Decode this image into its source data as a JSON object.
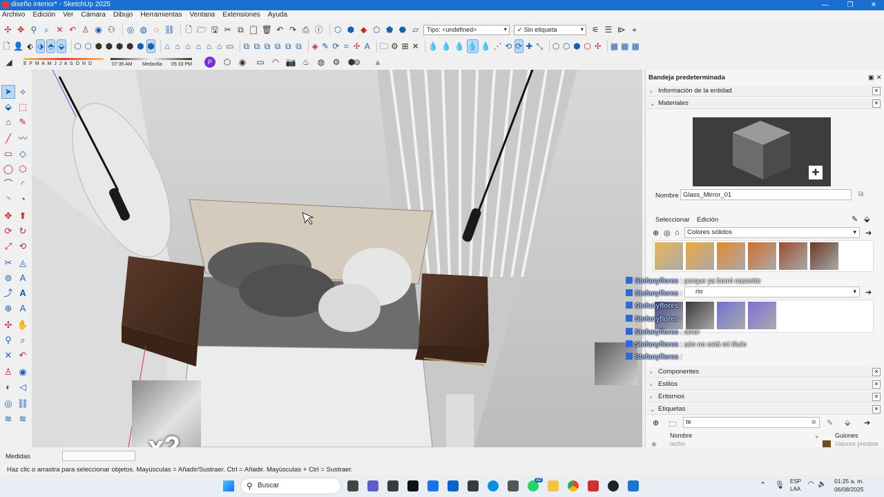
{
  "window": {
    "title": "diseño interior* - SketchUp 2025",
    "controls": [
      "—",
      "❐",
      "✕"
    ]
  },
  "menu": [
    "Archivo",
    "Edición",
    "Ver",
    "Cámara",
    "Dibujo",
    "Herramientas",
    "Ventana",
    "Extensiones",
    "Ayuda"
  ],
  "toolbar": {
    "type_label": "Tipo: <undefined>",
    "tag_label": "Sin etiqueta",
    "shadow_months": "E F M A M J J A S O N D",
    "shadow_time_start": "07:35 AM",
    "shadow_time_mid": "Mediodía",
    "shadow_time_end": "05:33 PM"
  },
  "tray": {
    "title": "Bandeja predeterminada",
    "entity_info": "Información de la entidad",
    "materials": "Materiales",
    "name_label": "Nombre",
    "material_name": "Glass_Mirror_01",
    "tab_select": "Seleccionar",
    "tab_edit": "Edición",
    "library": "Colores sólidos",
    "library2_partial": "rio",
    "components": "Componentes",
    "styles": "Estilos",
    "environments": "Entornos",
    "tags": "Etiquetas",
    "tag_search": "te",
    "col_name": "Nombre",
    "col_dashes": "Guiones",
    "row_name": "techo",
    "row_dashes": "Valores predete",
    "swatch_colors": [
      "#e8b653",
      "#eea63e",
      "#e38a2c",
      "#d56d2b",
      "#9a4f2e",
      "#6a3a27"
    ],
    "swatch2_colors": [
      "#454a8a",
      "#3a3a3a",
      "#6f72d4",
      "#7d6fd8"
    ]
  },
  "chat": [
    {
      "user": "Stefanyflores",
      "text": " : porque ya borró cassette"
    },
    {
      "user": "Stefanyflores",
      "text": " :"
    },
    {
      "user": "Stefanyflores",
      "text": " :"
    },
    {
      "user": "Stefanyflores",
      "text": " :"
    },
    {
      "user": "Stefanyflores",
      "text": " : amor"
    },
    {
      "user": "Stefanyflores",
      "text": " : aún no está mi título"
    },
    {
      "user": "Stefanyflores",
      "text": " :"
    }
  ],
  "overlay": {
    "multiplier": "x2"
  },
  "status": {
    "measures_label": "Medidas",
    "hint": "Haz clic o arrastra para seleccionar objetos. Mayúsculas = Añadir/Sustraer. Ctrl = Añadir. Mayúsculas + Ctrl = Sustraer."
  },
  "taskbar": {
    "search": "Buscar",
    "lang": "ESP",
    "region": "LAA",
    "time": "01:25 a. m.",
    "date": "06/08/2025",
    "notif_count": "32"
  }
}
